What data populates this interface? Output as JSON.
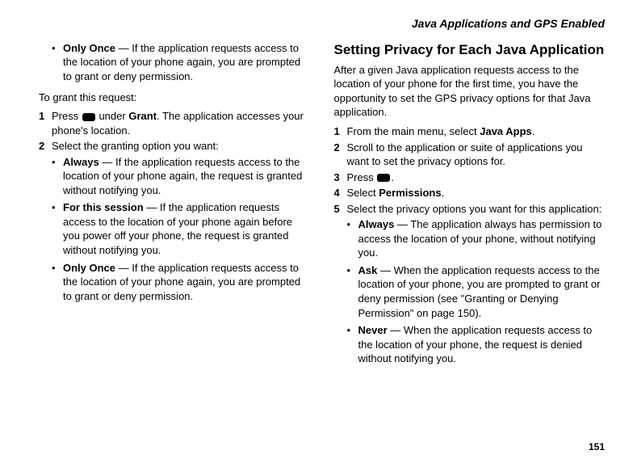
{
  "header": "Java Applications and GPS Enabled",
  "page_number": "151",
  "left": {
    "bullet1_bold": "Only Once",
    "bullet1_text": " — If the application requests access to the location of your phone again, you are prompted to grant or deny permission.",
    "intro": "To grant this request:",
    "step1_pre": "Press ",
    "step1_mid": " under ",
    "step1_bold": "Grant",
    "step1_post": ". The application accesses your phone's location.",
    "step2": "Select the granting option you want:",
    "sb1_bold": "Always",
    "sb1_text": " — If the application requests access to the location of your phone again, the request is granted without notifying you.",
    "sb2_bold": "For this session",
    "sb2_text": " — If the application requests access to the location of your phone again before you power off your phone, the request is granted without notifying you.",
    "sb3_bold": "Only Once",
    "sb3_text": " — If the application requests access to the location of your phone again, you are prompted to grant or deny permission."
  },
  "right": {
    "heading": "Setting Privacy for Each Java Application",
    "para": "After a given Java application requests access to the location of your phone for the first time, you have the opportunity to set the GPS privacy options for that Java application.",
    "s1_pre": "From the main menu, select ",
    "s1_bold": "Java Apps",
    "s1_post": ".",
    "s2": "Scroll to the application or suite of applications you want to set the privacy options for.",
    "s3_pre": "Press ",
    "s3_post": ".",
    "s4_pre": "Select ",
    "s4_bold": "Permissions",
    "s4_post": ".",
    "s5": "Select the privacy options you want for this application:",
    "rb1_bold": "Always",
    "rb1_text": " — The application always has permission to access the location of your phone, without notifying you.",
    "rb2_bold": "Ask",
    "rb2_text": " — When the application requests access to the location of your phone, you are prompted to grant or deny permission (see \"Granting or Denying Permission\" on page 150).",
    "rb3_bold": "Never",
    "rb3_text": " — When the application requests access to the location of your phone, the request is denied without notifying you."
  }
}
